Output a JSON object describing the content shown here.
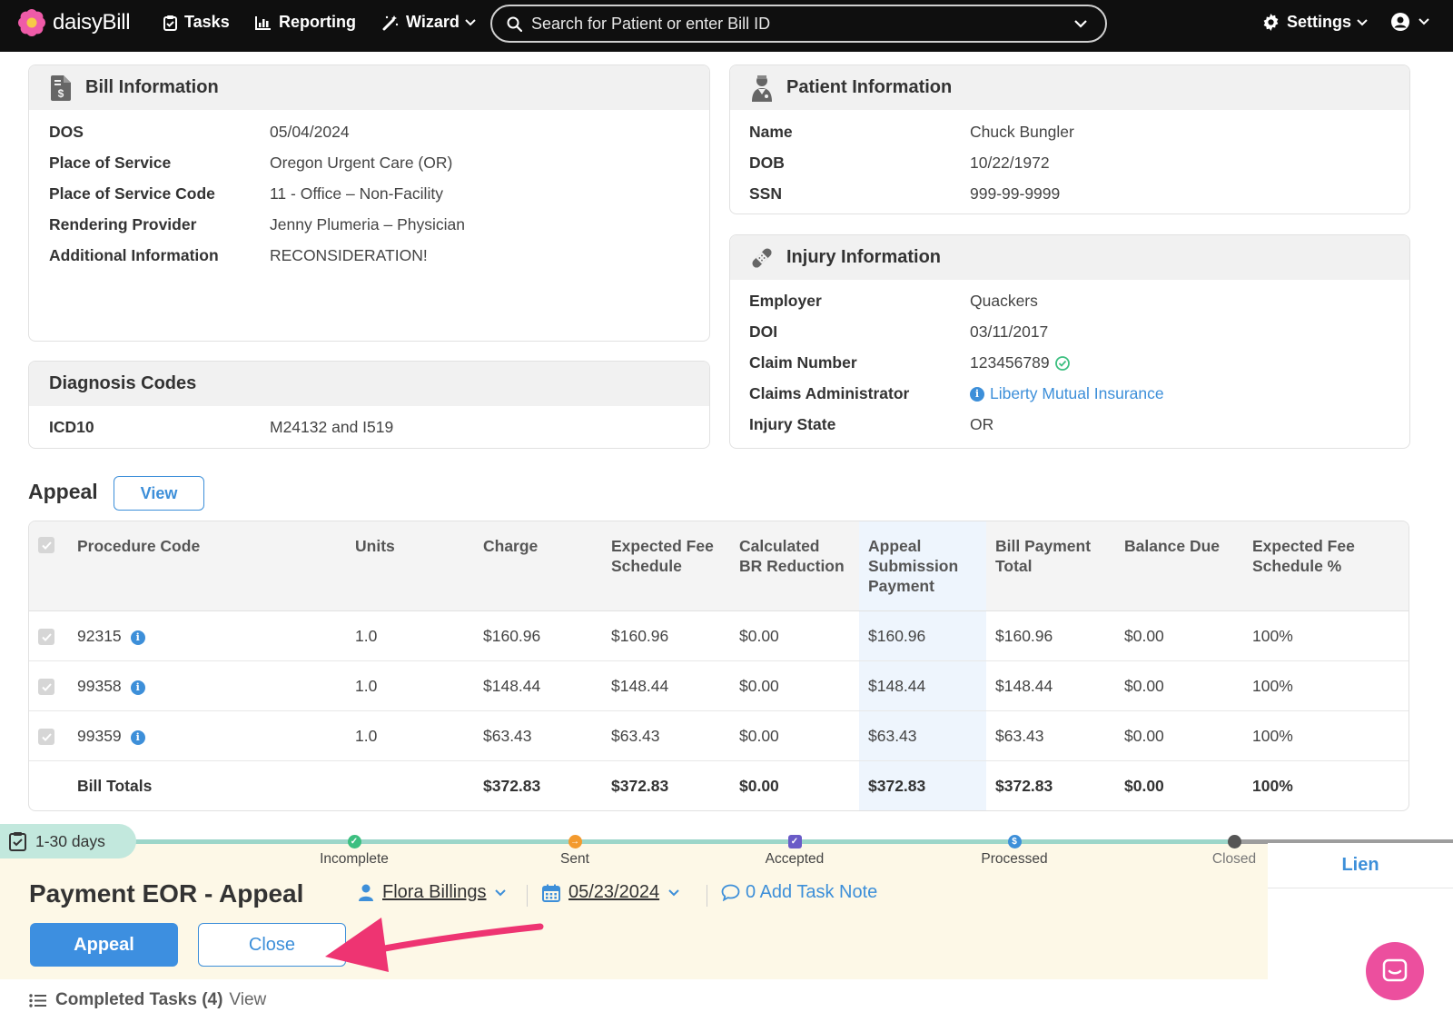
{
  "nav": {
    "brand": "daisyBill",
    "tasks": "Tasks",
    "reporting": "Reporting",
    "wizard": "Wizard",
    "search_placeholder": "Search for Patient or enter Bill ID",
    "settings": "Settings"
  },
  "bill_info": {
    "title": "Bill Information",
    "rows": [
      {
        "label": "DOS",
        "value": "05/04/2024"
      },
      {
        "label": "Place of Service",
        "value": "Oregon Urgent Care (OR)"
      },
      {
        "label": "Place of Service Code",
        "value": "11 - Office – Non-Facility"
      },
      {
        "label": "Rendering Provider",
        "value": "Jenny Plumeria – Physician"
      },
      {
        "label": "Additional Information",
        "value": "RECONSIDERATION!"
      }
    ]
  },
  "patient_info": {
    "title": "Patient Information",
    "rows": [
      {
        "label": "Name",
        "value": "Chuck Bungler"
      },
      {
        "label": "DOB",
        "value": "10/22/1972"
      },
      {
        "label": "SSN",
        "value": "999-99-9999"
      }
    ]
  },
  "injury_info": {
    "title": "Injury Information",
    "rows": [
      {
        "label": "Employer",
        "value": "Quackers"
      },
      {
        "label": "DOI",
        "value": "03/11/2017"
      },
      {
        "label": "Claim Number",
        "value": "123456789"
      },
      {
        "label": "Claims Administrator",
        "value": "Liberty Mutual Insurance"
      },
      {
        "label": "Injury State",
        "value": "OR"
      }
    ]
  },
  "diagnosis": {
    "title": "Diagnosis Codes",
    "label": "ICD10",
    "value": "M24132 and I519"
  },
  "appeal": {
    "title": "Appeal",
    "view_label": "View",
    "headers": {
      "procedure": "Procedure Code",
      "units": "Units",
      "charge": "Charge",
      "efs_1": "Expected Fee",
      "efs_2": "Schedule",
      "cbr_1": "Calculated",
      "cbr_2": "BR Reduction",
      "asp_1": "Appeal",
      "asp_2": "Submission",
      "asp_3": "Payment",
      "bpt_1": "Bill Payment",
      "bpt_2": "Total",
      "balance": "Balance Due",
      "efsp_1": "Expected Fee",
      "efsp_2": "Schedule %"
    },
    "rows": [
      {
        "code": "92315",
        "units": "1.0",
        "charge": "$160.96",
        "efs": "$160.96",
        "cbr": "$0.00",
        "asp": "$160.96",
        "bpt": "$160.96",
        "balance": "$0.00",
        "efsp": "100%"
      },
      {
        "code": "99358",
        "units": "1.0",
        "charge": "$148.44",
        "efs": "$148.44",
        "cbr": "$0.00",
        "asp": "$148.44",
        "bpt": "$148.44",
        "balance": "$0.00",
        "efsp": "100%"
      },
      {
        "code": "99359",
        "units": "1.0",
        "charge": "$63.43",
        "efs": "$63.43",
        "cbr": "$0.00",
        "asp": "$63.43",
        "bpt": "$63.43",
        "balance": "$0.00",
        "efsp": "100%"
      }
    ],
    "totals": {
      "label": "Bill Totals",
      "charge": "$372.83",
      "efs": "$372.83",
      "cbr": "$0.00",
      "asp": "$372.83",
      "bpt": "$372.83",
      "balance": "$0.00",
      "efsp": "100%"
    }
  },
  "task": {
    "age": "1-30 days",
    "steps": [
      "Incomplete",
      "Sent",
      "Accepted",
      "Processed",
      "Closed"
    ],
    "title": "Payment EOR - Appeal",
    "assignee": "Flora Billings",
    "due_date": "05/23/2024",
    "note": "0 Add Task Note",
    "appeal_label": "Appeal",
    "close_label": "Close",
    "side_tab": "Lien"
  },
  "completed": {
    "label": "Completed Tasks (4)",
    "view": "View"
  },
  "colors": {
    "accent": "#3d8fd9",
    "nav_bg": "#0f0f0f",
    "task_bg": "#fdf8e7",
    "annotation_arrow": "#ee3472"
  }
}
